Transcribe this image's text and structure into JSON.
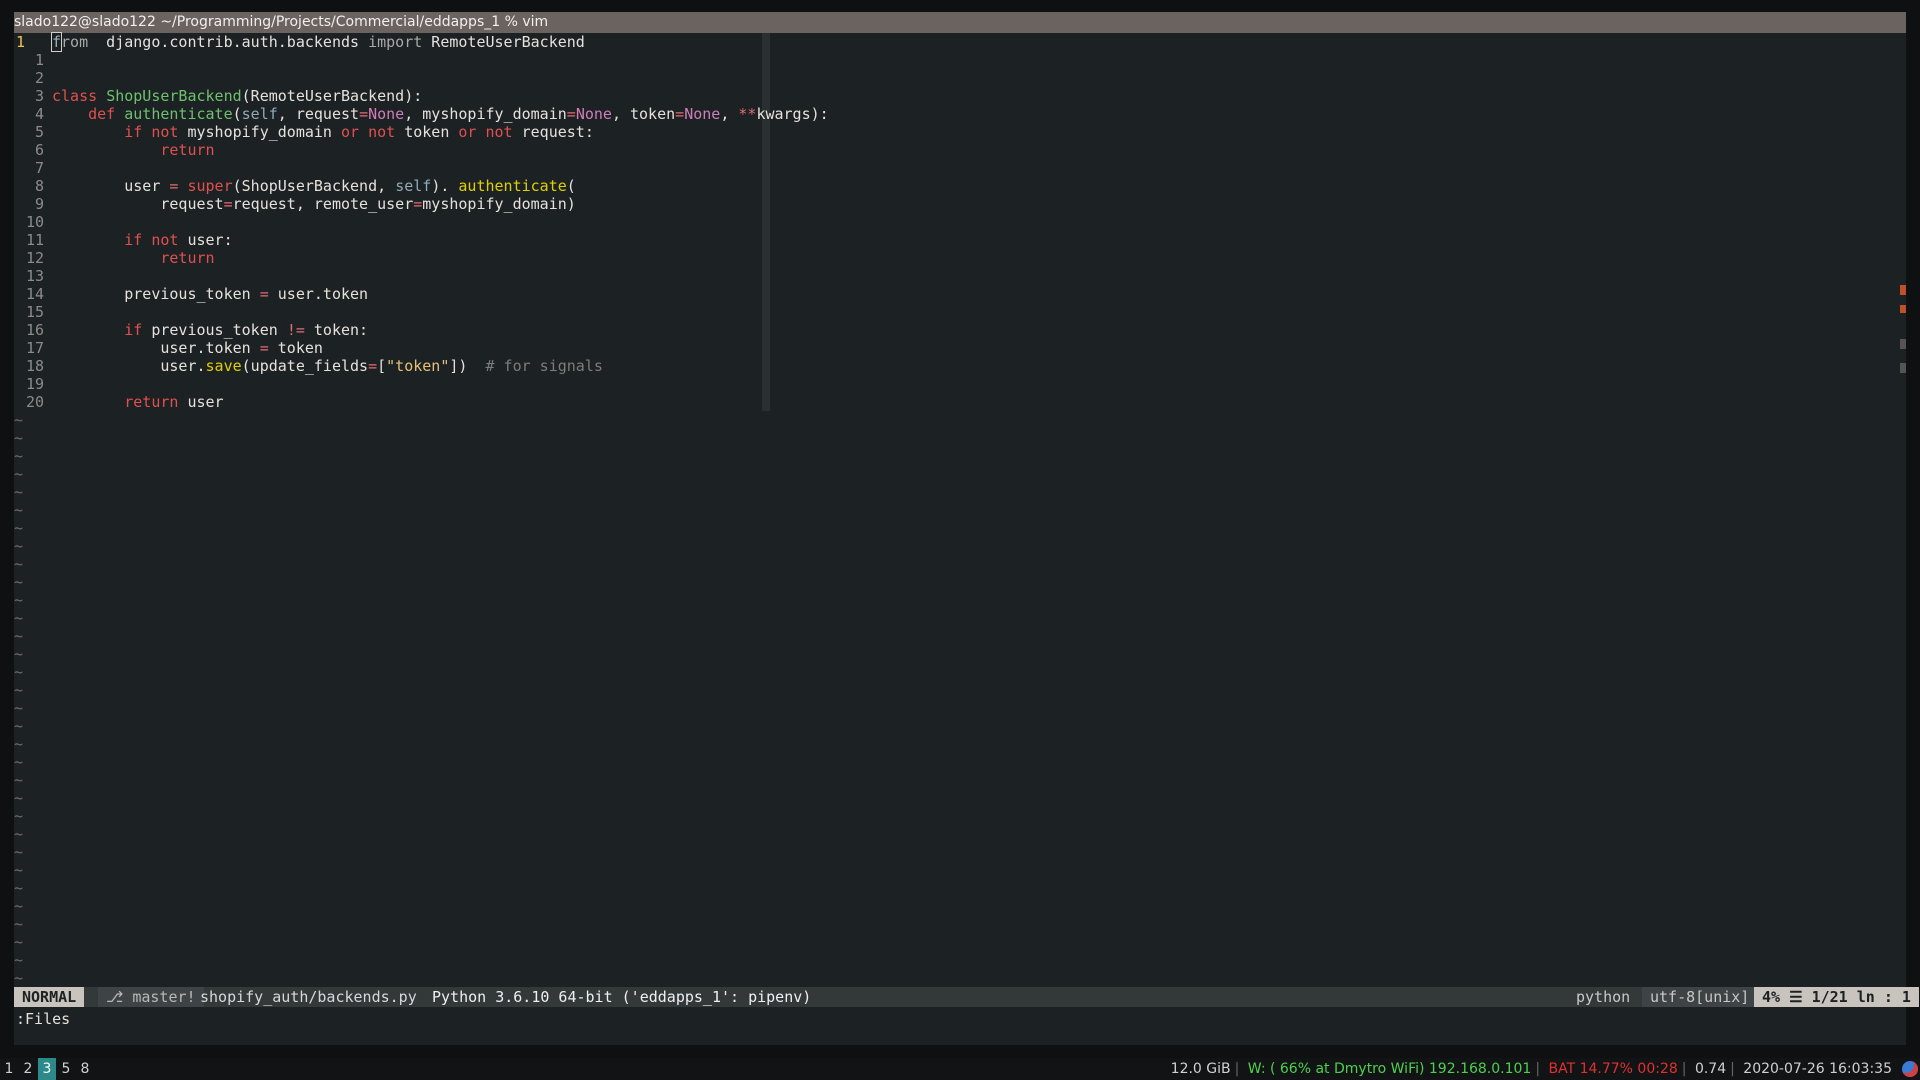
{
  "window": {
    "title": "slado122@slado122 ~/Programming/Projects/Commercial/eddapps_1 % vim"
  },
  "editor": {
    "current_line_number": "1",
    "lines": [
      {
        "n": "1",
        "segs": [
          [
            "cursor",
            "f"
          ],
          [
            "imp",
            "rom"
          ],
          [
            "",
            "  django.contrib.auth.backends "
          ],
          [
            "imp",
            "import"
          ],
          [
            "",
            " RemoteUserBackend"
          ]
        ]
      },
      {
        "n": "1",
        "segs": []
      },
      {
        "n": "2",
        "segs": []
      },
      {
        "n": "3",
        "segs": [
          [
            "kw",
            "class"
          ],
          [
            "",
            " "
          ],
          [
            "fn",
            "ShopUserBackend"
          ],
          [
            "",
            "(RemoteUserBackend):"
          ]
        ]
      },
      {
        "n": "4",
        "segs": [
          [
            "",
            "    "
          ],
          [
            "kw",
            "def"
          ],
          [
            "",
            " "
          ],
          [
            "fn",
            "authenticate"
          ],
          [
            "",
            "("
          ],
          [
            "self",
            "self"
          ],
          [
            "",
            ", request"
          ],
          [
            "op",
            "="
          ],
          [
            "none",
            "None"
          ],
          [
            "",
            ", myshopify_domain"
          ],
          [
            "op",
            "="
          ],
          [
            "none",
            "None"
          ],
          [
            "",
            ", token"
          ],
          [
            "op",
            "="
          ],
          [
            "none",
            "None"
          ],
          [
            "",
            ", "
          ],
          [
            "op",
            "**"
          ],
          [
            "",
            "kwargs):"
          ]
        ]
      },
      {
        "n": "5",
        "segs": [
          [
            "",
            "        "
          ],
          [
            "kw",
            "if"
          ],
          [
            "",
            " "
          ],
          [
            "kw",
            "not"
          ],
          [
            "",
            " myshopify_domain "
          ],
          [
            "kw",
            "or"
          ],
          [
            "",
            " "
          ],
          [
            "kw",
            "not"
          ],
          [
            "",
            " token "
          ],
          [
            "kw",
            "or"
          ],
          [
            "",
            " "
          ],
          [
            "kw",
            "not"
          ],
          [
            "",
            " request:"
          ]
        ]
      },
      {
        "n": "6",
        "segs": [
          [
            "",
            "            "
          ],
          [
            "kw",
            "return"
          ]
        ]
      },
      {
        "n": "7",
        "segs": []
      },
      {
        "n": "8",
        "segs": [
          [
            "",
            "        user "
          ],
          [
            "op",
            "="
          ],
          [
            "",
            " "
          ],
          [
            "kw",
            "super"
          ],
          [
            "",
            "(ShopUserBackend, "
          ],
          [
            "self",
            "self"
          ],
          [
            "",
            "). "
          ],
          [
            "method",
            "authenticate"
          ],
          [
            "",
            "("
          ]
        ]
      },
      {
        "n": "9",
        "segs": [
          [
            "",
            "            request"
          ],
          [
            "op",
            "="
          ],
          [
            "",
            "request, remote_user"
          ],
          [
            "op",
            "="
          ],
          [
            "",
            "myshopify_domain)"
          ]
        ]
      },
      {
        "n": "10",
        "segs": []
      },
      {
        "n": "11",
        "segs": [
          [
            "",
            "        "
          ],
          [
            "kw",
            "if"
          ],
          [
            "",
            " "
          ],
          [
            "kw",
            "not"
          ],
          [
            "",
            " user:"
          ]
        ]
      },
      {
        "n": "12",
        "segs": [
          [
            "",
            "            "
          ],
          [
            "kw",
            "return"
          ]
        ]
      },
      {
        "n": "13",
        "segs": []
      },
      {
        "n": "14",
        "segs": [
          [
            "",
            "        previous_token "
          ],
          [
            "op",
            "="
          ],
          [
            "",
            " user.token"
          ]
        ]
      },
      {
        "n": "15",
        "segs": []
      },
      {
        "n": "16",
        "segs": [
          [
            "",
            "        "
          ],
          [
            "kw",
            "if"
          ],
          [
            "",
            " previous_token "
          ],
          [
            "op",
            "!="
          ],
          [
            "",
            " token:"
          ]
        ]
      },
      {
        "n": "17",
        "segs": [
          [
            "",
            "            user.token "
          ],
          [
            "op",
            "="
          ],
          [
            "",
            " token"
          ]
        ]
      },
      {
        "n": "18",
        "segs": [
          [
            "",
            "            user."
          ],
          [
            "method",
            "save"
          ],
          [
            "",
            "(update_fields"
          ],
          [
            "op",
            "="
          ],
          [
            "",
            "["
          ],
          [
            "str",
            "\"token\""
          ],
          [
            "",
            "])  "
          ],
          [
            "comment",
            "# for signals"
          ]
        ]
      },
      {
        "n": "19",
        "segs": []
      },
      {
        "n": "20",
        "segs": [
          [
            "",
            "        "
          ],
          [
            "kw",
            "return"
          ],
          [
            "",
            " user"
          ]
        ]
      }
    ],
    "tilde": "~"
  },
  "statusline": {
    "mode": "NORMAL",
    "branch": "master!",
    "file": "shopify_auth/backends.py",
    "interpreter": "Python 3.6.10 64-bit ('eddapps_1': pipenv)",
    "filetype": "python",
    "encoding": "utf-8[unix]",
    "position": "4% ☰ 1/21  ln : 1"
  },
  "cmdline": ":Files",
  "taskbar": {
    "workspaces": [
      "1",
      "2",
      "3",
      "5",
      "8"
    ],
    "active_workspace": "3",
    "memory": "12.0 GiB",
    "wifi": "W: ( 66% at Dmytro WiFi) 192.168.0.101",
    "battery": "BAT 14.77% 00:28",
    "load": "0.74",
    "datetime": "2020-07-26 16:03:35"
  },
  "colors": {
    "wifi": "#4ed04e",
    "battery": "#e03030",
    "active_workspace": "#2d8a8a"
  }
}
